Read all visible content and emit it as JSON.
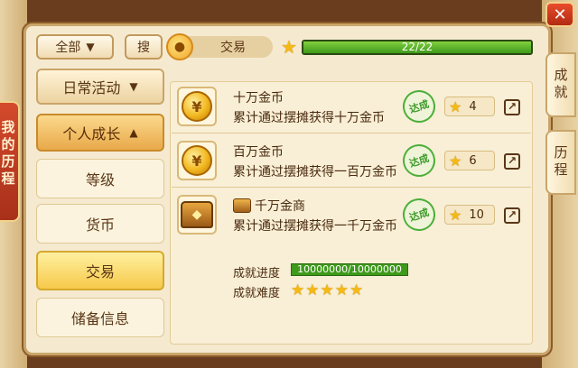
{
  "side_tab": {
    "label": "我的历程"
  },
  "filter": {
    "label": "全部"
  },
  "search": {
    "label": "搜"
  },
  "breadcrumb": {
    "label": "交易"
  },
  "progress": {
    "text": "22/22",
    "current": 22,
    "total": 22
  },
  "close": {
    "label": "✕"
  },
  "right_tabs": [
    {
      "label": "成就"
    },
    {
      "label": "历程"
    }
  ],
  "nav": {
    "categories": [
      {
        "label": "日常活动",
        "expanded": false
      },
      {
        "label": "个人成长",
        "expanded": true
      }
    ],
    "subs": [
      {
        "label": "等级"
      },
      {
        "label": "货币"
      },
      {
        "label": "交易",
        "active": true
      },
      {
        "label": "储备信息"
      }
    ]
  },
  "achievements": [
    {
      "icon": "gold-coin-icon",
      "title": "十万金币",
      "desc": "累计通过摆摊获得十万金币",
      "stamp": "达成",
      "points": "4"
    },
    {
      "icon": "gold-coin-icon",
      "title": "百万金币",
      "desc": "累计通过摆摊获得一百万金币",
      "stamp": "达成",
      "points": "6"
    },
    {
      "icon": "treasure-chest-icon",
      "title": "千万金商",
      "desc": "累计通过摆摊获得一千万金币",
      "stamp": "达成",
      "points": "10"
    }
  ],
  "detail": {
    "progress_label": "成就进度",
    "progress_value": "10000000/10000000",
    "difficulty_label": "成就难度",
    "difficulty_stars": 5
  },
  "colors": {
    "accent_green": "#3e9a1a",
    "star_gold": "#f5b913",
    "panel_bg": "#f5ead0"
  }
}
